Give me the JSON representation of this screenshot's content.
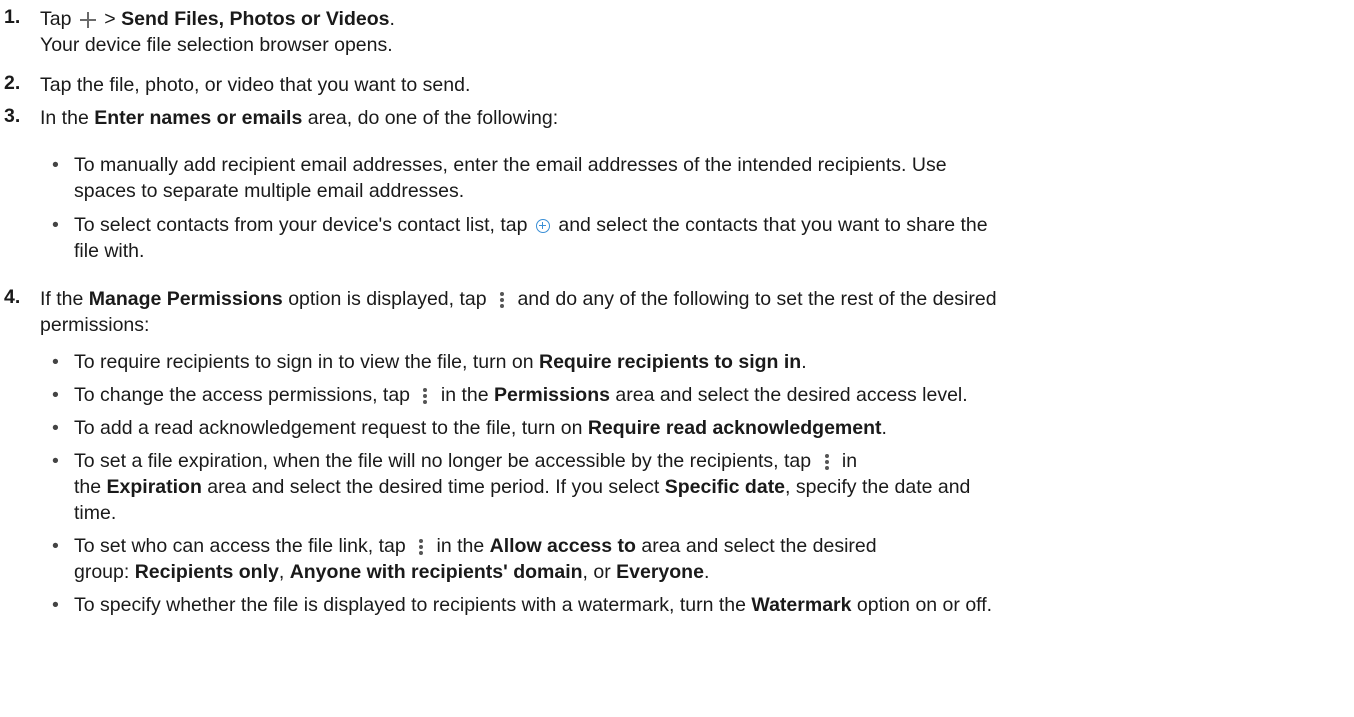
{
  "steps": [
    {
      "num": "1.",
      "tap": "Tap",
      "sep": " > ",
      "bold": "Send Files, Photos or Videos",
      "end": ".",
      "line2": "Your device file selection browser opens."
    },
    {
      "num": "2.",
      "text": "Tap the file, photo, or video that you want to send."
    },
    {
      "num": "3.",
      "pre": "In the ",
      "bold": "Enter names or emails",
      "post": " area, do one of the following:",
      "bullets": [
        {
          "line1": "To manually add recipient email addresses, enter the email addresses of the intended recipients. Use",
          "line2": "spaces to separate multiple email addresses."
        },
        {
          "pre": "To select contacts from your device's contact list, tap",
          "post": "and select the contacts that you want to share the",
          "line2": "file with."
        }
      ]
    },
    {
      "num": "4.",
      "pre": "If the ",
      "bold": "Manage Permissions",
      "mid": " option is displayed, tap",
      "post": "and do any of the following to set the rest of the desired",
      "line2": "permissions:",
      "bullets": [
        {
          "pre": "To require recipients to sign in to view the file, turn on ",
          "bold": "Require recipients to sign in",
          "end": "."
        },
        {
          "pre": "To change the access permissions, tap",
          "mid": "in the ",
          "bold": "Permissions",
          "post": " area and select the desired access level."
        },
        {
          "pre": "To add a read acknowledgement request to the file, turn on ",
          "bold": "Require read acknowledgement",
          "end": "."
        },
        {
          "pre": "To set a file expiration, when the file will no longer be accessible by the recipients, tap",
          "post": "in",
          "l2pre": "the ",
          "l2bold": "Expiration",
          "l2mid": "  area and select the desired time period. If you select ",
          "l2bold2": "Specific date",
          "l2post": ", specify the date and",
          "line3": "time."
        },
        {
          "pre": "To set who can access the file link, tap",
          "mid": "in the ",
          "bold": "Allow access to",
          "post": " area and select the desired",
          "l2pre": "group: ",
          "opt1": "Recipients only",
          "c1": ", ",
          "opt2": "Anyone with recipients' domain",
          "c2": ", or ",
          "opt3": "Everyone",
          "end": "."
        },
        {
          "pre": "To specify whether the file is displayed to recipients with a watermark, turn the ",
          "bold": "Watermark",
          "post": " option on or off."
        }
      ]
    }
  ],
  "bullet_glyph": "•"
}
